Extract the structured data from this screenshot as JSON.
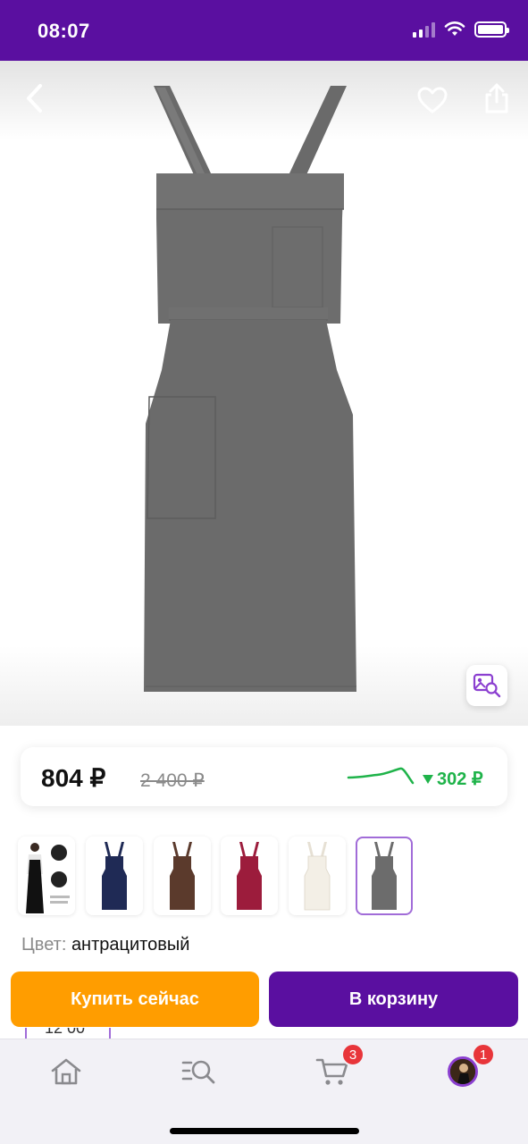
{
  "status_bar": {
    "time": "08:07"
  },
  "product": {
    "price": "804 ₽",
    "old_price": "2 400 ₽",
    "price_drop": "302 ₽",
    "color_label": "Цвет:",
    "color_value": "антрацитовый"
  },
  "variants": [
    {
      "name": "promo",
      "color": "#111111"
    },
    {
      "name": "navy",
      "color": "#1f2a55"
    },
    {
      "name": "brown",
      "color": "#5b3a2c"
    },
    {
      "name": "burgundy",
      "color": "#9c1c3c"
    },
    {
      "name": "white",
      "color": "#f3efe6"
    },
    {
      "name": "anthracite",
      "color": "#6c6c6c",
      "selected": true
    }
  ],
  "actions": {
    "buy_now": "Купить сейчас",
    "add_to_cart": "В корзину"
  },
  "peek_text": "12 00",
  "tabbar": {
    "cart_badge": "3",
    "profile_badge": "1"
  },
  "colors": {
    "brand": "#5a0fa0",
    "buy": "#ff9d00",
    "drop": "#1fb34a",
    "badge": "#e8353a"
  }
}
